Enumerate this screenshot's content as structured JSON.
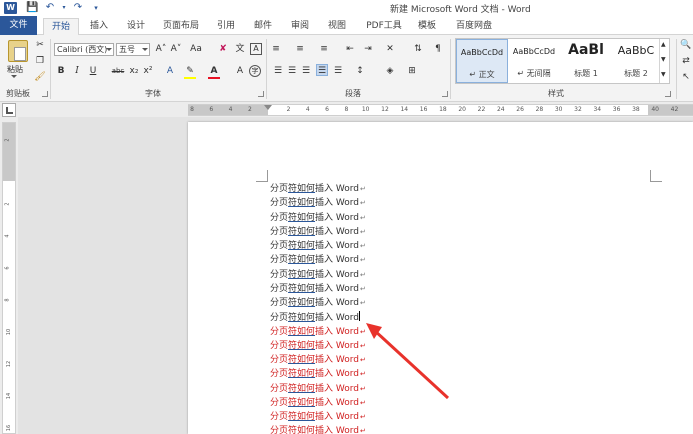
{
  "title_bar": {
    "logo": "W",
    "title": "新建 Microsoft Word 文档 - Word",
    "quick_access": [
      "save-icon",
      "undo-icon",
      "redo-icon",
      "customize-icon"
    ]
  },
  "tabs": {
    "file": "文件",
    "items": [
      "开始",
      "插入",
      "设计",
      "页面布局",
      "引用",
      "邮件",
      "审阅",
      "视图",
      "PDF工具",
      "模板",
      "百度网盘"
    ],
    "active_index": 0
  },
  "ribbon": {
    "clipboard": {
      "label": "剪贴板",
      "paste": "粘贴"
    },
    "font": {
      "label": "字体",
      "font_name": "Calibri (西文)",
      "font_size": "五号",
      "grow": "A˄",
      "shrink": "A˅",
      "aa": "Aa",
      "bold": "B",
      "italic": "I",
      "underline": "U",
      "strike": "abc",
      "subscript": "x₂",
      "superscript": "x²",
      "font_color_letter": "A",
      "highlight_color": "#ffff00",
      "font_color": "#e81123"
    },
    "paragraph": {
      "label": "段落"
    },
    "styles": {
      "label": "样式",
      "items": [
        {
          "sample": "AaBbCcDd",
          "name": "↵ 正文",
          "selected": true
        },
        {
          "sample": "AaBbCcDd",
          "name": "↵ 无间隔",
          "selected": false
        },
        {
          "sample": "AaBl",
          "name": "标题 1",
          "selected": false
        },
        {
          "sample": "AaBbC",
          "name": "标题 2",
          "selected": false
        }
      ]
    }
  },
  "ruler": {
    "h_ticks": [
      "8",
      "6",
      "4",
      "2",
      "",
      "2",
      "4",
      "6",
      "8",
      "10",
      "12",
      "14",
      "16",
      "18",
      "20",
      "22",
      "24",
      "26",
      "28",
      "30",
      "32",
      "34",
      "36",
      "38",
      "40",
      "42"
    ],
    "v_ticks": [
      "2",
      "",
      "2",
      "4",
      "6",
      "8",
      "10",
      "12",
      "14",
      "16"
    ]
  },
  "document": {
    "lines": [
      {
        "prefix": "分页",
        "hl": "符如何",
        "suffix": "插入 Word",
        "mark": "↵",
        "color": "black"
      },
      {
        "prefix": "分页",
        "hl": "符如何",
        "suffix": "插入 Word",
        "mark": "↵",
        "color": "black"
      },
      {
        "prefix": "分页",
        "hl": "符如何",
        "suffix": "插入 Word",
        "mark": "↵",
        "color": "black"
      },
      {
        "prefix": "分页",
        "hl": "符如何",
        "suffix": "插入 Word",
        "mark": "↵",
        "color": "black"
      },
      {
        "prefix": "分页",
        "hl": "符如何",
        "suffix": "插入 Word",
        "mark": "↵",
        "color": "black"
      },
      {
        "prefix": "分页",
        "hl": "符如何",
        "suffix": "插入 Word",
        "mark": "↵",
        "color": "black"
      },
      {
        "prefix": "分页",
        "hl": "符如何",
        "suffix": "插入 Word",
        "mark": "↵",
        "color": "black"
      },
      {
        "prefix": "分页",
        "hl": "符如何",
        "suffix": "插入 Word",
        "mark": "↵",
        "color": "black"
      },
      {
        "prefix": "分页",
        "hl": "符如何",
        "suffix": "插入 Word",
        "mark": "↵",
        "color": "black"
      },
      {
        "prefix": "分页",
        "hl": "符如何",
        "suffix": "插入 Word",
        "mark": "",
        "color": "black",
        "cursor": true
      },
      {
        "prefix": "分页",
        "hl": "符如何",
        "suffix": "插入 Word",
        "mark": "↵",
        "color": "red"
      },
      {
        "prefix": "分页",
        "hl": "符如何",
        "suffix": "插入 Word",
        "mark": "↵",
        "color": "red"
      },
      {
        "prefix": "分页",
        "hl": "符如何",
        "suffix": "插入 Word",
        "mark": "↵",
        "color": "red"
      },
      {
        "prefix": "分页",
        "hl": "符如何",
        "suffix": "插入 Word",
        "mark": "↵",
        "color": "red"
      },
      {
        "prefix": "分页",
        "hl": "符如何",
        "suffix": "插入 Word",
        "mark": "↵",
        "color": "red"
      },
      {
        "prefix": "分页",
        "hl": "符如何",
        "suffix": "插入 Word",
        "mark": "↵",
        "color": "red"
      },
      {
        "prefix": "分页",
        "hl": "符如何",
        "suffix": "插入 Word",
        "mark": "↵",
        "color": "red"
      },
      {
        "prefix": "分页",
        "hl": "符如何",
        "suffix": "插入 Word",
        "mark": "↵",
        "color": "red"
      }
    ],
    "annotation_arrow_color": "#e8322b"
  }
}
